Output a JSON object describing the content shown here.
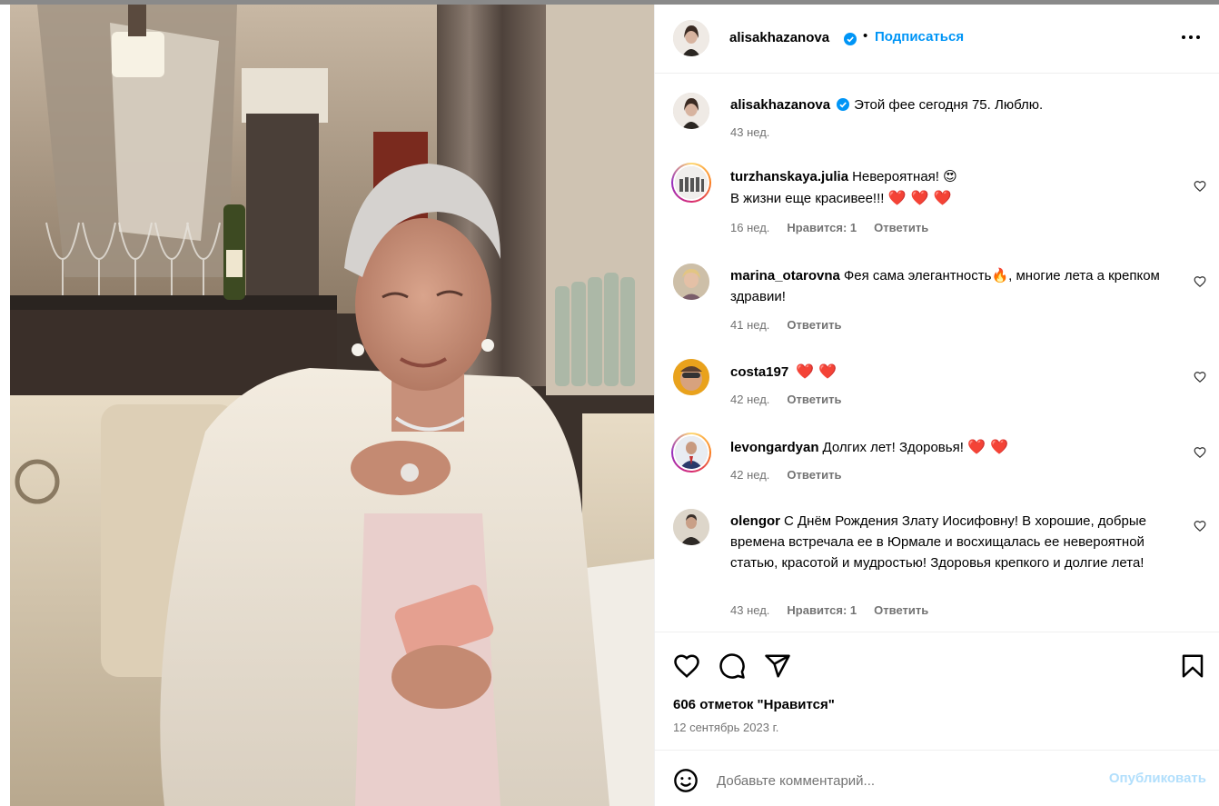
{
  "post": {
    "author": "alisakhazanova",
    "follow_label": "Подписаться",
    "dot": "•",
    "caption_text": "Этой фее сегодня 75. Люблю.",
    "caption_time": "43 нед."
  },
  "comments": [
    {
      "username": "turzhanskaya.julia",
      "line1": "Невероятная!",
      "emoji1": "😍",
      "line2": "В жизни еще красивее!!!",
      "hearts": "❤️ ❤️ ❤️",
      "time": "16 нед.",
      "likes": "Нравится: 1",
      "reply": "Ответить"
    },
    {
      "username": "marina_otarovna",
      "text_a": "Фея сама элегантность",
      "emoji": "🔥",
      "text_b": ", многие лета а крепком здравии!",
      "time": "41 нед.",
      "reply": "Ответить"
    },
    {
      "username": "costa197",
      "hearts": "❤️ ❤️",
      "time": "42 нед.",
      "reply": "Ответить"
    },
    {
      "username": "levongardyan",
      "text": "Долгих лет! Здоровья!",
      "hearts": "❤️ ❤️",
      "time": "42 нед.",
      "reply": "Ответить"
    },
    {
      "username": "olengor",
      "text": "С Днём Рождения Злату Иосифовну! В хорошие, добрые времена встречала ее в Юрмале и восхищалась ее невероятной статью, красотой и мудростью! Здоровья крепкого и долгие лета!",
      "time": "43 нед.",
      "likes": "Нравится: 1",
      "reply": "Ответить"
    }
  ],
  "footer": {
    "likes_count": "606 отметок \"Нравится\"",
    "date": "12 сентябрь 2023 г.",
    "comment_placeholder": "Добавьте комментарий...",
    "publish_label": "Опубликовать"
  },
  "icons": {
    "verified": "verified-badge-icon",
    "more": "more-options-icon",
    "like": "heart-outline-icon",
    "comment": "comment-bubble-icon",
    "share": "paper-plane-icon",
    "save": "bookmark-icon",
    "emoji": "emoji-smile-icon"
  },
  "colors": {
    "accent": "#0095f6",
    "muted": "#737373",
    "publish_disabled": "#b2dffc",
    "verified": "#0095f6"
  }
}
